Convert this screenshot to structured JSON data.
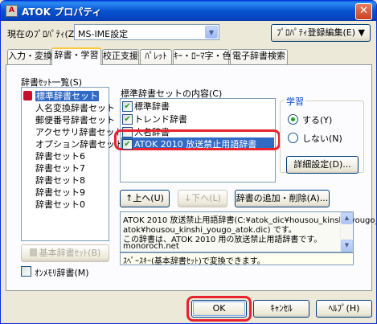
{
  "window": {
    "title": "ATOK プロパティ",
    "icon_text": "A",
    "close_glyph": "✕"
  },
  "header": {
    "current_property_label": "現在のﾌﾟﾛﾊﾟﾃｨ(Z)",
    "current_property_value": "MS-IME設定",
    "property_edit_button": "ﾌﾟﾛﾊﾟﾃｨ登録編集(E) ▼"
  },
  "tabs": [
    {
      "label": "入力・変換",
      "active": false
    },
    {
      "label": "辞書・学習",
      "active": true
    },
    {
      "label": "校正支援",
      "active": false
    },
    {
      "label": "ﾊﾟﾚｯﾄ",
      "active": false
    },
    {
      "label": "ｷｰ・ﾛｰﾏ字・色",
      "active": false
    },
    {
      "label": "電子辞書検索",
      "active": false
    }
  ],
  "dictionary_sets": {
    "label": "辞書ｾｯﾄ一覧(S)",
    "items": [
      "標準辞書セット",
      "人名変換辞書セット",
      "郵便番号辞書セット",
      "アクセサリ辞書セット",
      "オプション辞書セット",
      "辞書セット6",
      "辞書セット7",
      "辞書セット8",
      "辞書セット9",
      "辞書セット0"
    ],
    "selected_index": 0
  },
  "contents": {
    "label": "標準辞書セットの内容(C)",
    "items": [
      {
        "label": "標準辞書",
        "checked": true
      },
      {
        "label": "トレンド辞書",
        "checked": true
      },
      {
        "label": "人名辞書",
        "checked": false
      },
      {
        "label": "ATOK 2010 放送禁止用語辞書",
        "checked": true
      }
    ],
    "selected_index": 3
  },
  "learning": {
    "title": "学習",
    "options": [
      {
        "label": "する(Y)",
        "selected": true
      },
      {
        "label": "しない(N)",
        "selected": false
      }
    ],
    "detail_button": "詳細設定(D)..."
  },
  "actions": {
    "up_button": "↑上へ(U)",
    "down_button": "↓下へ(L)",
    "add_remove_button": "辞書の追加・削除(A)..."
  },
  "description": {
    "lines": [
      "ATOK 2010 放送禁止用語辞書(C:¥atok_dic¥housou_kinshi_yougo_",
      "atok¥housou_kinshi_yougo_atok.dic) です。",
      "この辞書は、ATOK 2010 用の放送禁止用語辞書です。",
      "monoroch.net"
    ],
    "hint": "ｽﾍﾟｰｽｷｰ(基本辞書ｾｯﾄ)で変換できます。"
  },
  "basic_set_button": "基本辞書ｾｯﾄ(B)",
  "online_dict_checkbox": {
    "label": "ｵﾝﾒﾓﾘ辞書(M)",
    "checked": false
  },
  "footer": {
    "ok": "OK",
    "cancel": "ｷｬﾝｾﾙ",
    "help": "ﾍﾙﾌﾟ(H)"
  },
  "colors": {
    "highlight": "#e8222e",
    "selection": "#316ac5",
    "titlebar": "#0753d0"
  }
}
